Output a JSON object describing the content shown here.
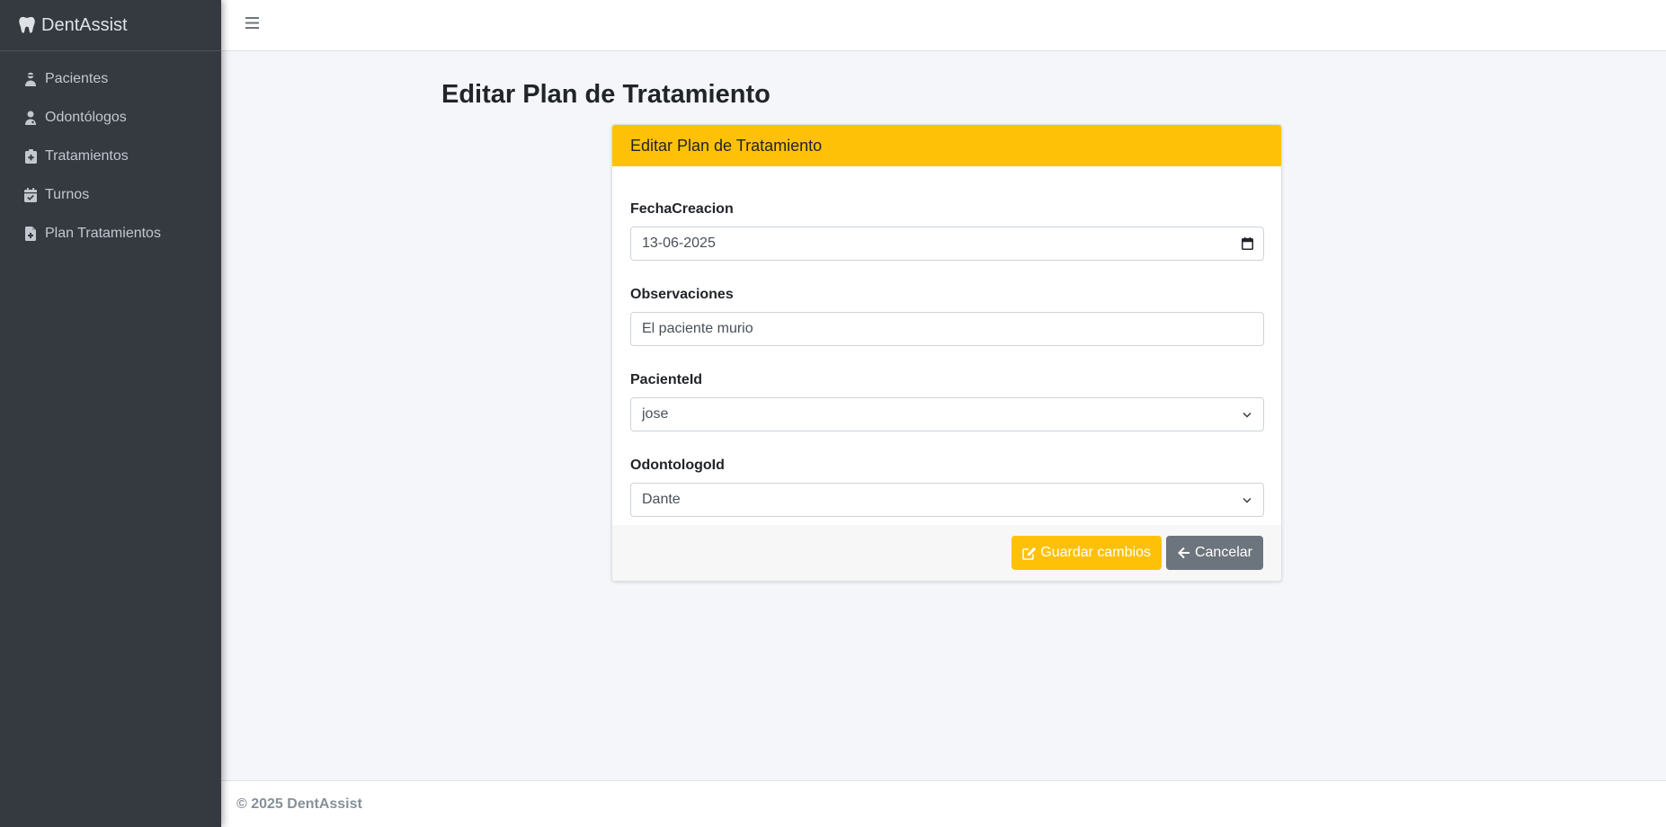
{
  "app": {
    "brand": "DentAssist"
  },
  "sidebar": {
    "items": [
      {
        "label": "Pacientes",
        "icon": "user-injured-icon"
      },
      {
        "label": "Odontólogos",
        "icon": "user-doctor-icon"
      },
      {
        "label": "Tratamientos",
        "icon": "notes-medical-icon"
      },
      {
        "label": "Turnos",
        "icon": "calendar-check-icon"
      },
      {
        "label": "Plan Tratamientos",
        "icon": "file-medical-icon"
      }
    ]
  },
  "page": {
    "title": "Editar Plan de Tratamiento"
  },
  "card": {
    "header": "Editar Plan de Tratamiento",
    "fields": {
      "fecha": {
        "label": "FechaCreacion",
        "value": "13-06-2025"
      },
      "observaciones": {
        "label": "Observaciones",
        "value": "El paciente murio"
      },
      "paciente": {
        "label": "PacienteId",
        "value": "jose"
      },
      "odontologo": {
        "label": "OdontologoId",
        "value": "Dante"
      }
    },
    "buttons": {
      "save": "Guardar cambios",
      "cancel": "Cancelar"
    }
  },
  "footer": {
    "copyright": "© 2025 DentAssist"
  },
  "colors": {
    "sidebar": "#343a40",
    "warning": "#ffc107",
    "secondary": "#6c757d",
    "background": "#f4f6f9"
  }
}
